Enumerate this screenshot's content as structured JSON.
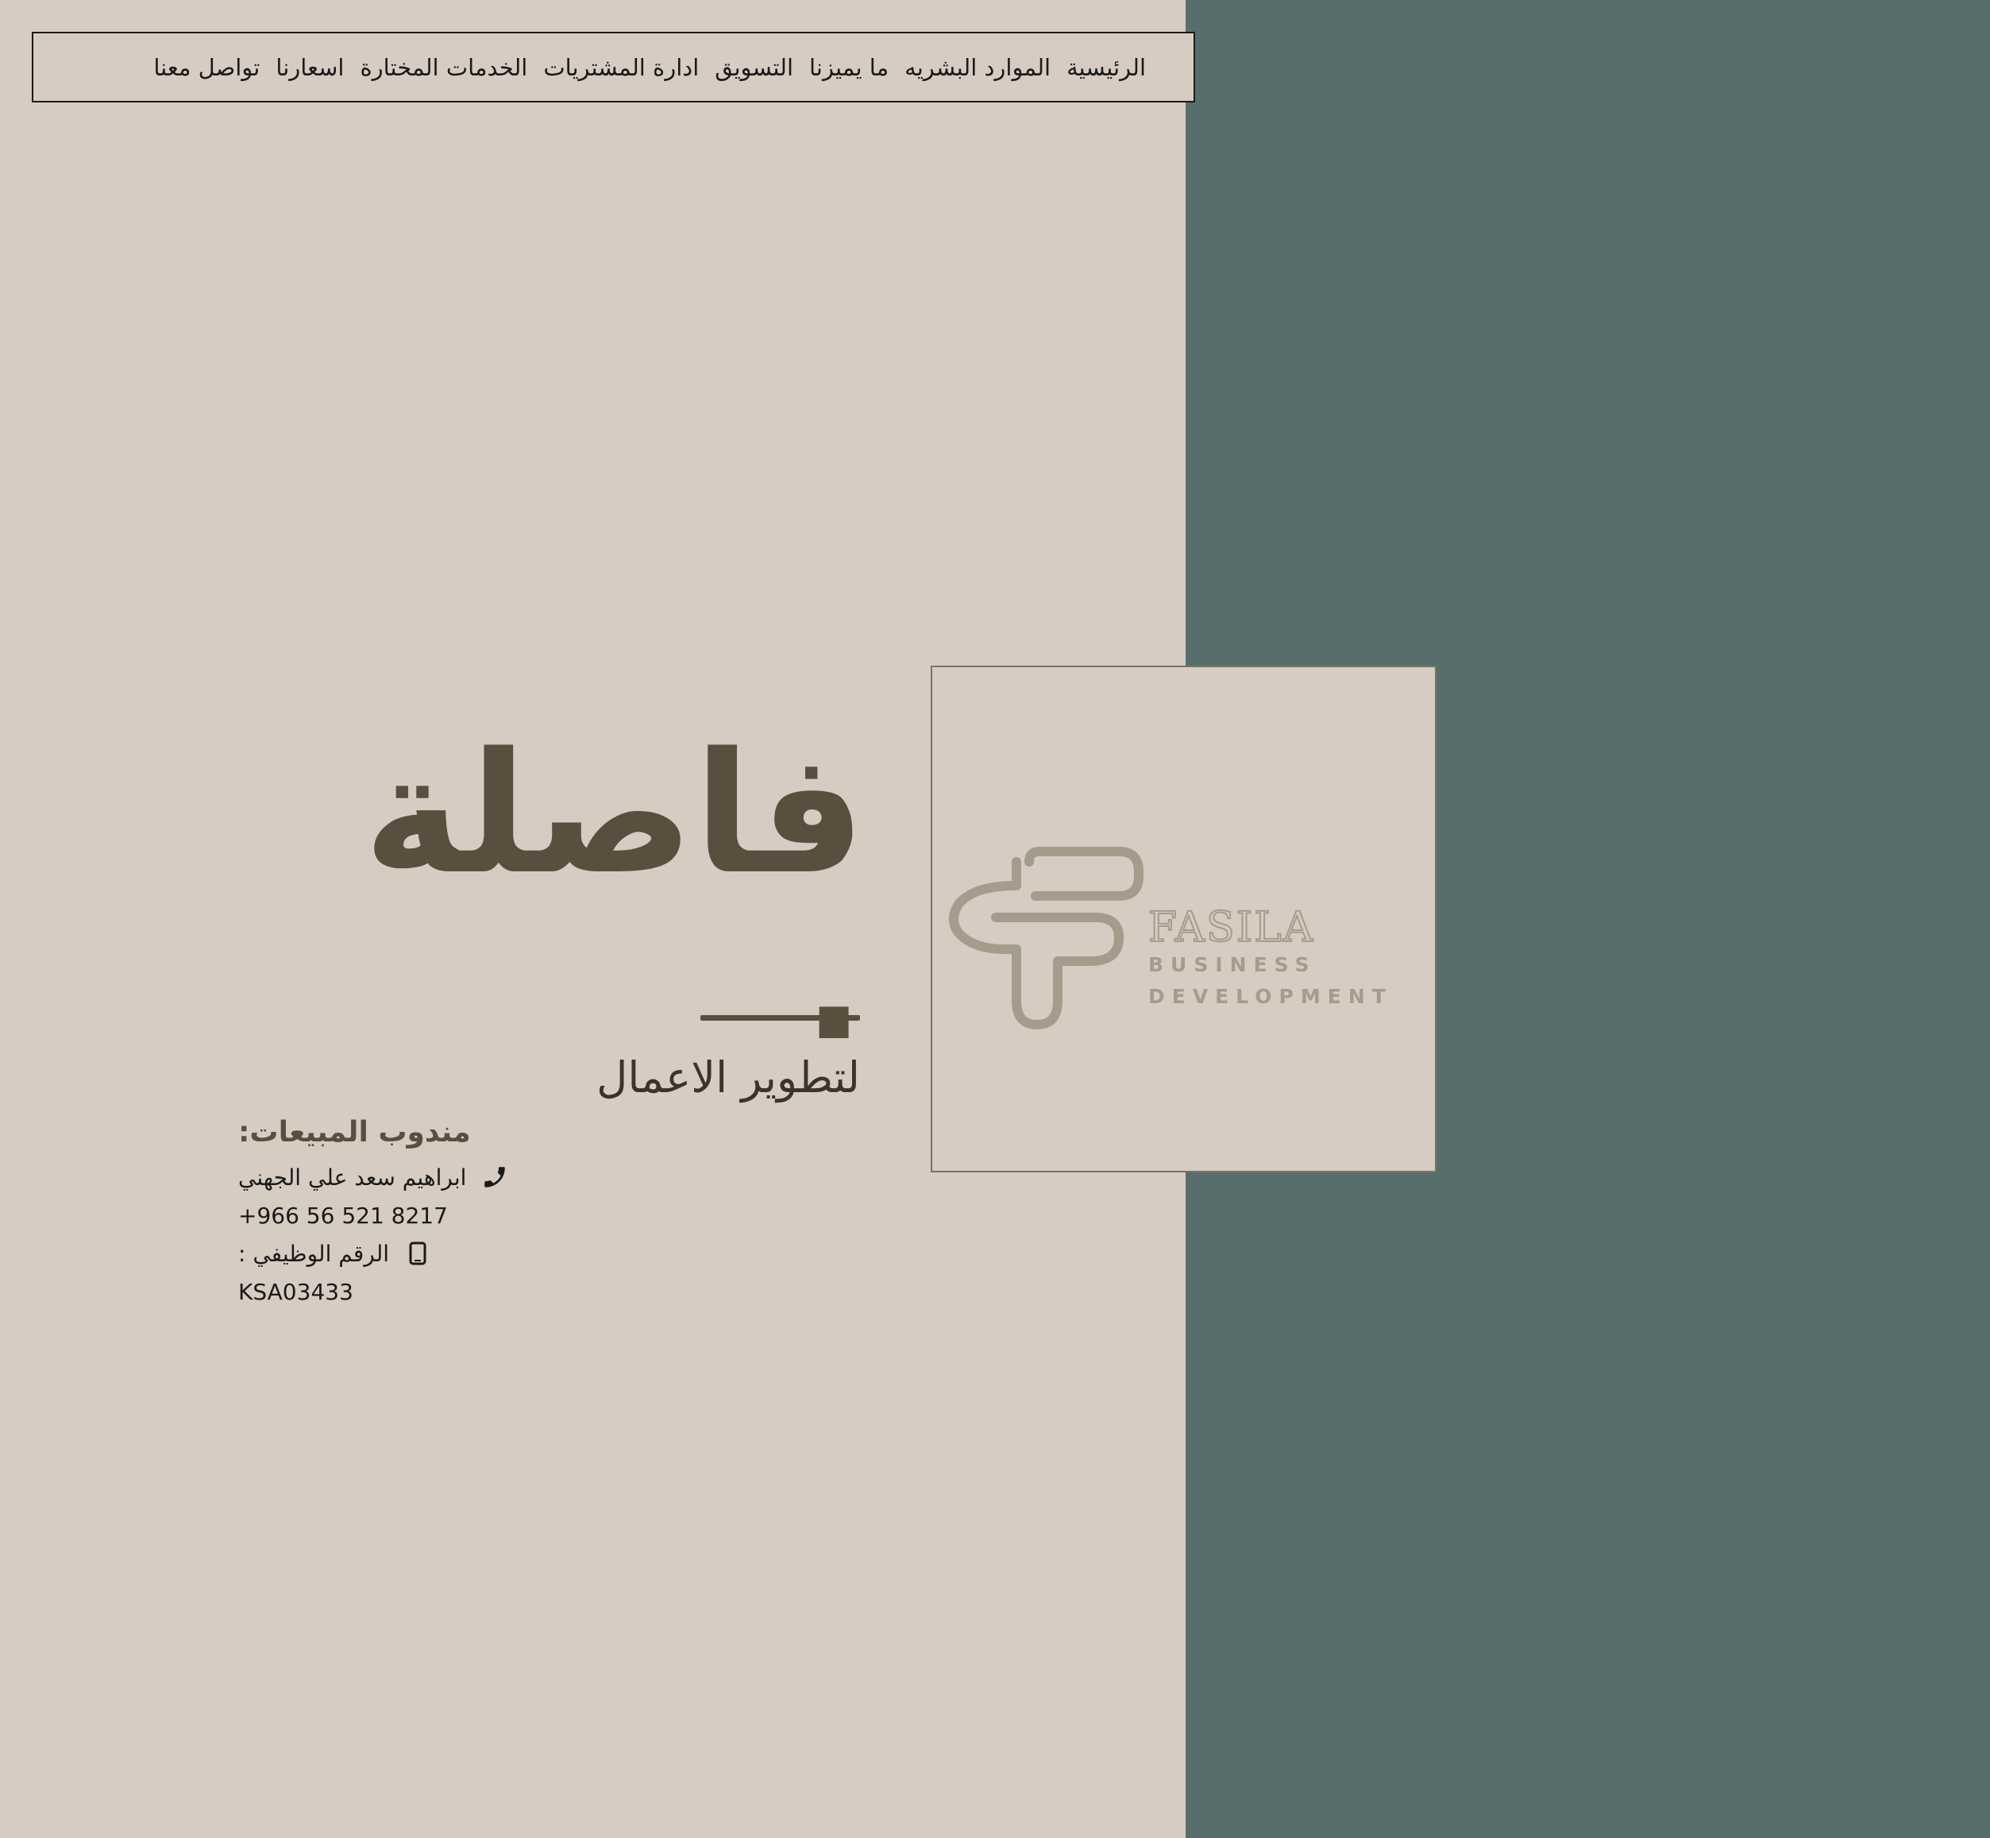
{
  "nav": {
    "items": [
      {
        "label": "الرئيسية"
      },
      {
        "label": "الموارد البشريه"
      },
      {
        "label": "ما يميزنا"
      },
      {
        "label": "التسويق"
      },
      {
        "label": "ادارة المشتريات"
      },
      {
        "label": "الخدمات المختارة"
      },
      {
        "label": "اسعارنا"
      },
      {
        "label": "تواصل معنا"
      }
    ]
  },
  "hero": {
    "title": "فاصلة .",
    "tagline": "لتطوير الاعمال"
  },
  "contact": {
    "heading": "مندوب المبيعات:",
    "name": "ابراهيم سعد علي الجهني",
    "phone": "+966 56 521 8217",
    "job_number_label": "الرقم الوظيفي :",
    "job_number": "KSA03433"
  },
  "logo": {
    "word": "FASILA",
    "line1": "BUSINESS",
    "line2": "DEVELOPMENT"
  },
  "colors": {
    "left_bg": "#d6ccc2",
    "right_bg": "#586e6c",
    "brand_brown": "#5a4f3f",
    "logo_gray": "#a49d8b"
  },
  "icons": {
    "phone": "phone-icon",
    "mobile": "mobile-icon"
  }
}
